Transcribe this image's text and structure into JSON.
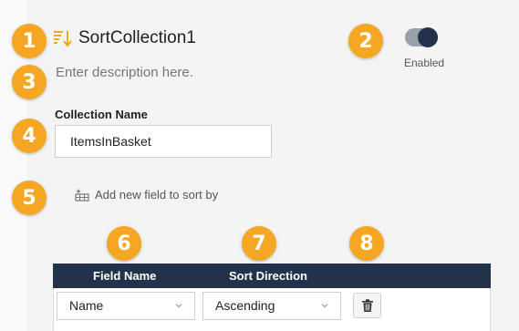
{
  "badges": [
    "1",
    "2",
    "3",
    "4",
    "5",
    "6",
    "7",
    "8"
  ],
  "header": {
    "icon": "sort-descending-icon",
    "title": "SortCollection1",
    "toggle_label": "Enabled",
    "toggle_on": true
  },
  "description_placeholder": "Enter description here.",
  "collection": {
    "label": "Collection Name",
    "value": "ItemsInBasket"
  },
  "add_field": {
    "icon": "add-row-icon",
    "label": "Add new field to sort by"
  },
  "table": {
    "columns": [
      "Field Name",
      "Sort Direction"
    ],
    "rows": [
      {
        "field_name": "Name",
        "sort_direction": "Ascending",
        "delete_icon": "trash-icon"
      }
    ]
  },
  "colors": {
    "badge": "#f5a623",
    "header_bg": "#22324a",
    "toggle_on": "#22324a"
  }
}
